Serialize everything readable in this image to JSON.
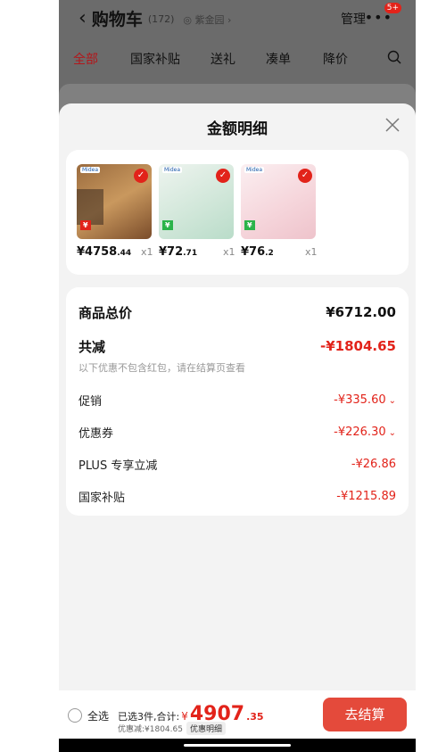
{
  "background": {
    "back_icon": "chevron-left-icon",
    "title": "购物车",
    "count": "(172)",
    "location": "◎ 紫金园 ›",
    "manage": "管理",
    "more": "•••",
    "badge": "5+",
    "tabs": [
      "全部",
      "国家补贴",
      "送礼",
      "凑单",
      "降价"
    ],
    "active_tab": "全部",
    "search_icon": "search-icon"
  },
  "sheet": {
    "title": "金额明细",
    "close_icon": "close-icon",
    "products": [
      {
        "price_int": "¥4758",
        "price_dec": ".44",
        "qty": "x1"
      },
      {
        "price_int": "¥72",
        "price_dec": ".71",
        "qty": "x1"
      },
      {
        "price_int": "¥76",
        "price_dec": ".2",
        "qty": "x1"
      }
    ],
    "summary": {
      "total_label": "商品总价",
      "total_value": "¥6712.00",
      "reduce_label": "共减",
      "reduce_value": "-¥1804.65",
      "hint": "以下优惠不包含红包，请在结算页查看",
      "promo_label": "促销",
      "promo_value": "-¥335.60",
      "coupon_label": "优惠券",
      "coupon_value": "-¥226.30",
      "plus_label": "PLUS 专享立减",
      "plus_value": "-¥26.86",
      "subsidy_label": "国家补贴",
      "subsidy_value": "-¥1215.89"
    }
  },
  "bottom": {
    "select_all": "全选",
    "selected_text": "已选3件,合计:",
    "currency": "¥",
    "amount_int": "4907",
    "amount_dec": ".35",
    "discount_text": "优惠减:¥1804.65",
    "detail_btn": "优惠明细",
    "checkout": "去结算"
  },
  "colors": {
    "accent": "#e2231a",
    "checkout": "#e44a3b",
    "sheet_bg": "#f3f3f3"
  }
}
